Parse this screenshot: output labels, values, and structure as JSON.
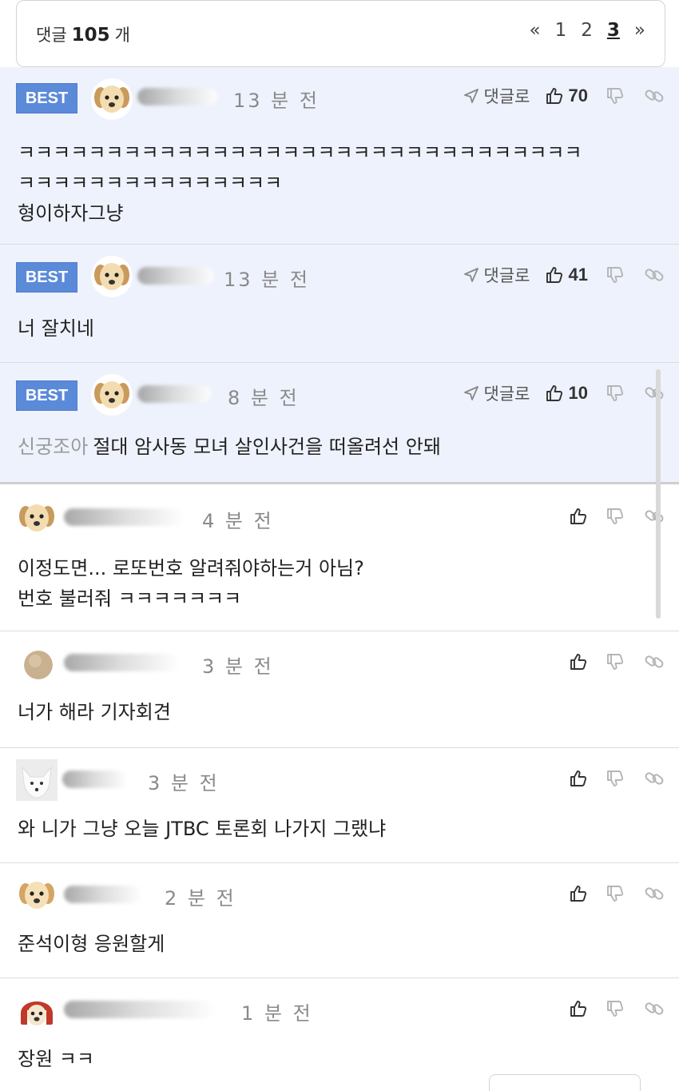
{
  "header": {
    "count_prefix": "댓글",
    "count": "105",
    "count_suffix": "개"
  },
  "pager": {
    "prev": "«",
    "pages": [
      "1",
      "2",
      "3"
    ],
    "current": "3",
    "next": "»"
  },
  "labels": {
    "best": "BEST",
    "reply": "댓글로"
  },
  "comments": [
    {
      "best": true,
      "time": "13 분 전",
      "likes": "70",
      "lines": [
        "ㅋㅋㅋㅋㅋㅋㅋㅋㅋㅋㅋㅋㅋㅋㅋㅋㅋㅋㅋㅋㅋㅋㅋㅋㅋㅋㅋㅋㅋㅋㅋㅋ",
        "ㅋㅋㅋㅋㅋㅋㅋㅋㅋㅋㅋㅋㅋㅋㅋ",
        "형이하자그냥"
      ],
      "avatar": "puppy-icon"
    },
    {
      "best": true,
      "time": "13 분 전",
      "likes": "41",
      "lines": [
        "너 잘치네"
      ],
      "avatar": "puppy-icon"
    },
    {
      "best": true,
      "time": "8 분 전",
      "likes": "10",
      "prefix": "신궁조아",
      "lines": [
        "절대 암사동 모녀 살인사건을 떠올려선 안돼"
      ],
      "avatar": "puppy-icon"
    },
    {
      "best": false,
      "time": "4 분 전",
      "lines": [
        "이정도면... 로또번호 알려줘야하는거 아님?",
        "번호 불러줘 ㅋㅋㅋㅋㅋㅋㅋ"
      ],
      "avatar": "puppy-icon"
    },
    {
      "best": false,
      "time": "3 분 전",
      "lines": [
        "너가 해라 기자회견"
      ],
      "avatar": "beige-circle-icon"
    },
    {
      "best": false,
      "time": "3 분 전",
      "lines": [
        "와 니가 그냥 오늘 JTBC 토론회 나가지 그랬냐"
      ],
      "avatar": "white-fox-icon"
    },
    {
      "best": false,
      "time": "2 분 전",
      "lines": [
        "준석이형 응원할게"
      ],
      "avatar": "puppy-icon"
    },
    {
      "best": false,
      "time": "1 분 전",
      "lines": [
        "장원 ㅋㅋ"
      ],
      "avatar": "red-hood-puppy-icon"
    }
  ],
  "colors": {
    "best_bg": "#eef2fc",
    "badge": "#5b8ad9",
    "muted": "#8a8a8a"
  }
}
